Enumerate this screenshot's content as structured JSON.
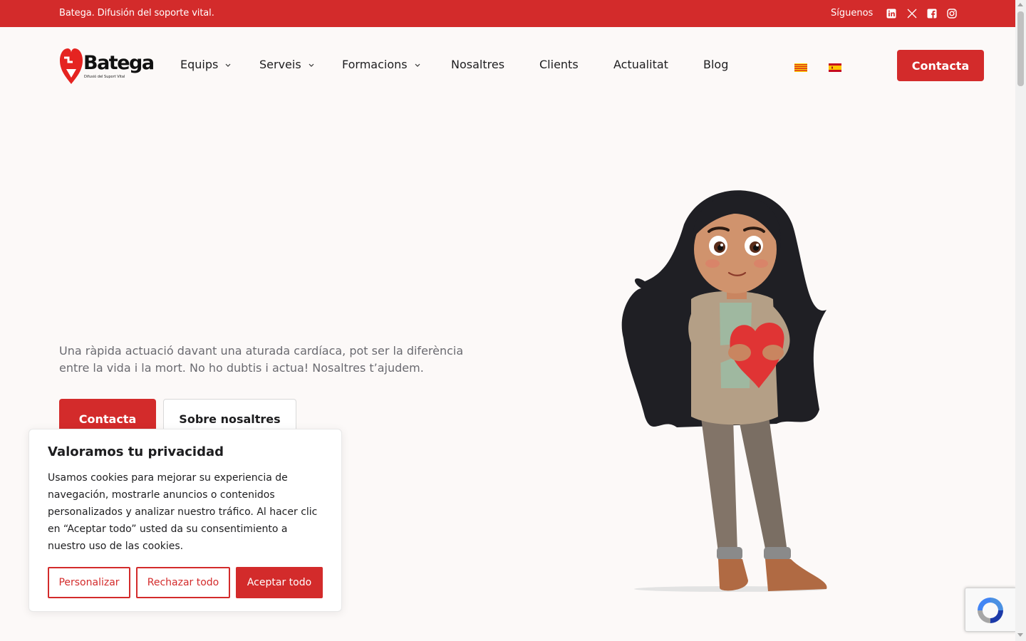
{
  "topbar": {
    "tagline": "Batega. Difusión del soporte vital.",
    "follow_label": "Síguenos",
    "social_icons": [
      "linkedin-icon",
      "x-icon",
      "facebook-icon",
      "instagram-icon"
    ]
  },
  "logo": {
    "word": "Batega",
    "sub": "Difusió del Suport Vital"
  },
  "nav": {
    "items": [
      {
        "label": "Equips",
        "dropdown": true
      },
      {
        "label": "Serveis",
        "dropdown": true
      },
      {
        "label": "Formacions",
        "dropdown": true
      },
      {
        "label": "Nosaltres",
        "dropdown": false
      },
      {
        "label": "Clients",
        "dropdown": false
      },
      {
        "label": "Actualitat",
        "dropdown": false
      },
      {
        "label": "Blog",
        "dropdown": false
      }
    ],
    "languages": [
      "catalan-flag",
      "spanish-flag"
    ],
    "cta_label": "Contacta"
  },
  "hero": {
    "text": "Una ràpida actuació davant una aturada cardíaca, pot ser la diferència entre la vida i la mort. No ho dubtis i actua!  Nosaltres t’ajudem.",
    "primary_label": "Contacta",
    "secondary_label": "Sobre nosaltres"
  },
  "cookie": {
    "title": "Valoramos tu privacidad",
    "body": "Usamos cookies para mejorar su experiencia de navegación, mostrarle anuncios o contenidos personalizados y analizar nuestro tráfico. Al hacer clic en “Aceptar todo” usted da su consentimiento a nuestro uso de las cookies.",
    "customize_label": "Personalizar",
    "reject_label": "Rechazar todo",
    "accept_label": "Aceptar todo"
  },
  "colors": {
    "brand_red": "#d32b2b",
    "background": "#fcf9f8",
    "text_dark": "#1d1d1f",
    "text_muted": "#6a6a70"
  }
}
